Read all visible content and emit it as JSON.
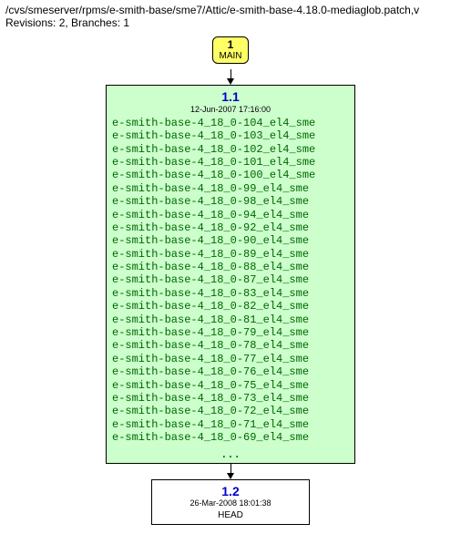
{
  "header": {
    "path": "/cvs/smeserver/rpms/e-smith-base/sme7/Attic/e-smith-base-4.18.0-mediaglob.patch,v",
    "revisions_line": "Revisions: 2, Branches: 1"
  },
  "main_branch": {
    "number": "1",
    "label": "MAIN"
  },
  "rev1": {
    "version": "1.1",
    "date": "12-Jun-2007 17:16:00",
    "tags": [
      "e-smith-base-4_18_0-104_el4_sme",
      "e-smith-base-4_18_0-103_el4_sme",
      "e-smith-base-4_18_0-102_el4_sme",
      "e-smith-base-4_18_0-101_el4_sme",
      "e-smith-base-4_18_0-100_el4_sme",
      "e-smith-base-4_18_0-99_el4_sme",
      "e-smith-base-4_18_0-98_el4_sme",
      "e-smith-base-4_18_0-94_el4_sme",
      "e-smith-base-4_18_0-92_el4_sme",
      "e-smith-base-4_18_0-90_el4_sme",
      "e-smith-base-4_18_0-89_el4_sme",
      "e-smith-base-4_18_0-88_el4_sme",
      "e-smith-base-4_18_0-87_el4_sme",
      "e-smith-base-4_18_0-83_el4_sme",
      "e-smith-base-4_18_0-82_el4_sme",
      "e-smith-base-4_18_0-81_el4_sme",
      "e-smith-base-4_18_0-79_el4_sme",
      "e-smith-base-4_18_0-78_el4_sme",
      "e-smith-base-4_18_0-77_el4_sme",
      "e-smith-base-4_18_0-76_el4_sme",
      "e-smith-base-4_18_0-75_el4_sme",
      "e-smith-base-4_18_0-73_el4_sme",
      "e-smith-base-4_18_0-72_el4_sme",
      "e-smith-base-4_18_0-71_el4_sme",
      "e-smith-base-4_18_0-69_el4_sme"
    ],
    "ellipsis": "..."
  },
  "rev2": {
    "version": "1.2",
    "date": "26-Mar-2008 18:01:38",
    "label": "HEAD"
  }
}
